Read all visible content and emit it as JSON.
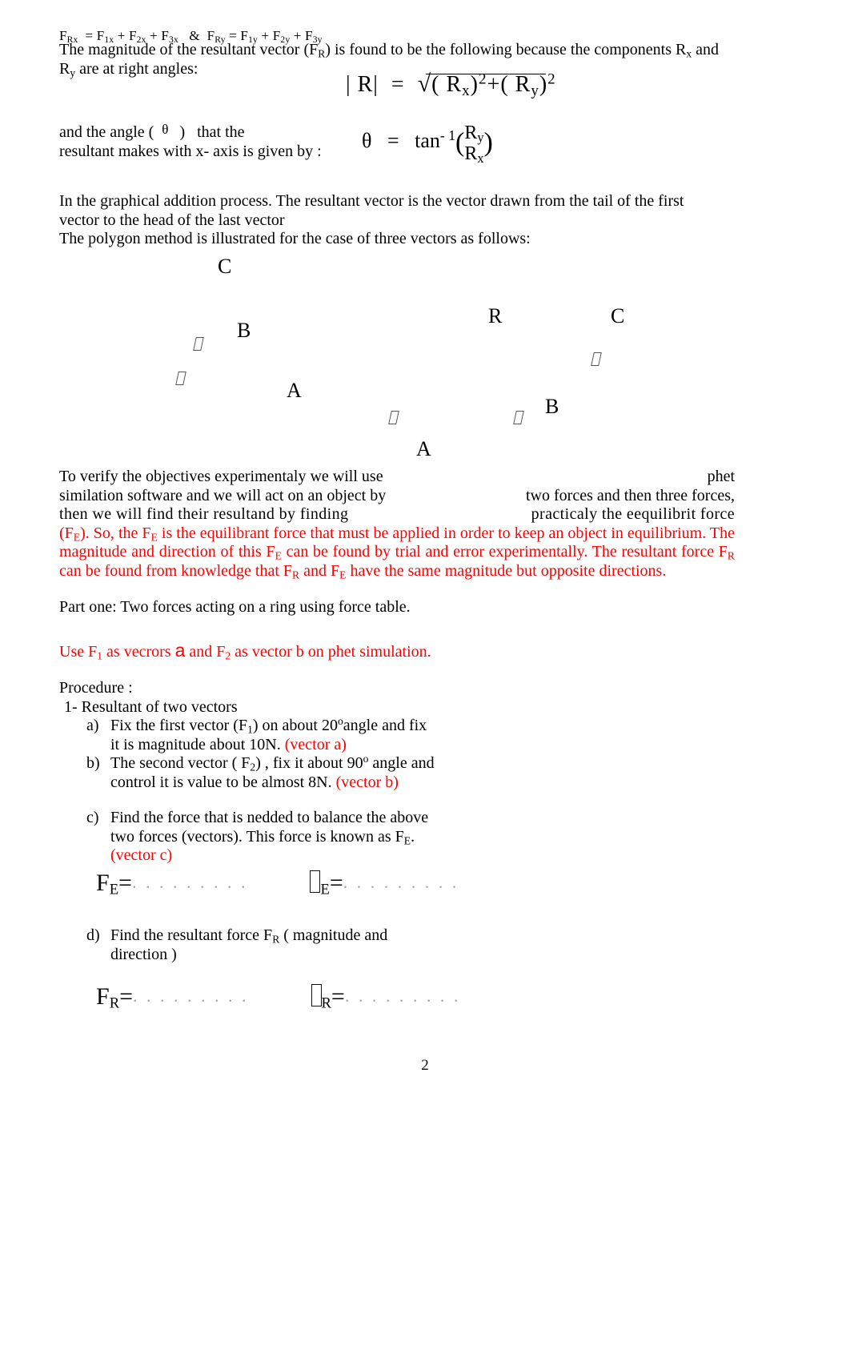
{
  "document": {
    "page_number": "2"
  },
  "component_equation": {
    "left": "F",
    "left_sub": "Rx",
    "eq1": " =  F",
    "terms": "F_Rx = F_1x + F_2x + F_3x  &  F_Ry = F_1y + F_2y + F_3y",
    "parts": {
      "f_rx": "F",
      "f_rx_sub": "Rx",
      "f1x": "F",
      "f1x_sub": "1x",
      "f2x": "F",
      "f2x_sub": "2x",
      "f3x": "F",
      "f3x_sub": "3x",
      "amp": "&",
      "f_ry": "F",
      "f_ry_sub": "Ry",
      "f1y": "F",
      "f1y_sub": "1y",
      "f2y": "F",
      "f2y_sub": "2y",
      "f3y": "F",
      "f3y_sub": "3y",
      "plus": "+",
      "equals": "="
    }
  },
  "intro_paragraph": {
    "line1_a": "The magnitude of the resultant vector (F",
    "line1_sub": "R",
    "line1_b": ") is found to be the following because the components R",
    "line1_sub2": "x",
    "line1_c": " and",
    "line2_a": "R",
    "line2_sub": "y",
    "line2_b": " are at right angles:"
  },
  "magnitude_formula": {
    "bar_r": "| R|",
    "equals": "=",
    "radical": "√",
    "open1": "( R",
    "sub_x": "x",
    "close1": ")",
    "sup1": "2",
    "plus": "+",
    "open2": "( R",
    "sub_y": "y",
    "close2": ")",
    "sup2": "2"
  },
  "angle_sentence": {
    "part1": "and the angle  (",
    "theta": "θ",
    "part2": ")",
    "part3": "that  the",
    "line2": "resultant makes with  x- axis is given by  :"
  },
  "theta_formula": {
    "theta": "θ",
    "equals": "=",
    "tan": "tan",
    "sup": "- 1",
    "open": "(",
    "numerator": "R",
    "numerator_sub": "y",
    "denominator": "R",
    "denominator_sub": "x",
    "close": ")"
  },
  "graphical_paragraph": {
    "line1": "In the graphical addition process. The resultant vector is the vector   drawn from the tail of the first",
    "line2": "vector to the head of the last vector",
    "line3": " The polygon method is illustrated for the case of three vectors  as follows:"
  },
  "diagram": {
    "left_figure": {
      "labels": [
        "C",
        "B",
        "A"
      ],
      "arrow_glyphs": [
        "⌷",
        "⌷",
        "⌷"
      ]
    },
    "right_figure": {
      "labels": [
        "R",
        "C",
        "B",
        "A"
      ],
      "arrow_glyphs": [
        "⌷",
        "⌷"
      ]
    }
  },
  "verify_paragraph": {
    "line1_left": "To verify the objectives experimentaly we will use",
    "line1_right": "phet",
    "line2_left": "similation software and we will act on an object by",
    "line2_right": "two forces and then three forces,",
    "line3_left": "then  we  will    find  their  resultand  by  finding",
    "line3_right": "practicaly  the  eequilibrit  force",
    "red_line1_a": "(F",
    "red_line1_sub": "E",
    "red_line1_b": "). So, the F",
    "red_line1_sub2": "E",
    "red_line1_c": " is the equilibrant force that must be applied in order to keep an object in equilibrium. The",
    "red_line2_a": "magnitude and direction of this F",
    "red_line2_sub": "E",
    "red_line2_b": " can be found by trial and error experimentally. The resultant force  F",
    "red_line2_sub2": "R",
    "red_line3_a": "can be found from knowledge that  F",
    "red_line3_sub": "R",
    "red_line3_b": " and   F",
    "red_line3_sub2": "E",
    "red_line3_c": " have the same magnitude but opposite directions."
  },
  "part_one": {
    "text": "Part one:  Two forces acting on a ring using force table."
  },
  "use_f1": {
    "a": "Use F",
    "sub1": "1",
    "b": " as vecrors ",
    "vector_a": "a",
    "c": " and F",
    "sub2": "2",
    "d": " as vector b on phet simulation."
  },
  "procedure": {
    "heading": "Procedure  :",
    "item1": "1- Resultant of two vectors",
    "items": [
      {
        "marker": "a)",
        "line1_a": "Fix the first vector (F",
        "line1_sub": "1",
        "line1_b": ")  on  about 20",
        "line1_deg": "o",
        "line1_c": "angle and fix",
        "line2": "it is magnitude about 10N.",
        "line2_red": "(vector a)"
      },
      {
        "marker": "b)",
        "line1_a": "The second vector ( F",
        "line1_sub": "2",
        "line1_b": ") , fix it about  90",
        "line1_deg": "o",
        "line1_c": " angle and",
        "line2": "control it is value to be almost 8N.",
        "line2_red": "(vector b)"
      },
      {
        "marker": "c)",
        "line1": "Find the force that is nedded to balance the above",
        "line2_a": "two forces (vectors). This force is known as F",
        "line2_sub": "E",
        "line2_b": ".",
        "line3_red": "(vector c)"
      },
      {
        "marker": "d)",
        "line1_a": "Find the resultant force  F",
        "line1_sub": "R",
        "line1_b": "  ( magnitude and",
        "line2": "direction )"
      }
    ]
  },
  "answers": {
    "force_e": {
      "label": "F",
      "label_sub": "E",
      "equals": "=",
      "dots": ". . . . . . . . .",
      "theta_label_sub": "E",
      "theta_equals": "=",
      "theta_dots": ". . . . . . . . ."
    },
    "force_r": {
      "label": "F",
      "label_sub": "R",
      "equals": "=",
      "dots": ". . . . . . . . .",
      "theta_label_sub": "R",
      "theta_equals": "=",
      "theta_dots": ". . . . . . . . ."
    }
  },
  "colors": {
    "red": "#ff0000",
    "text": "#000000",
    "dots": "#a8a8a8"
  }
}
